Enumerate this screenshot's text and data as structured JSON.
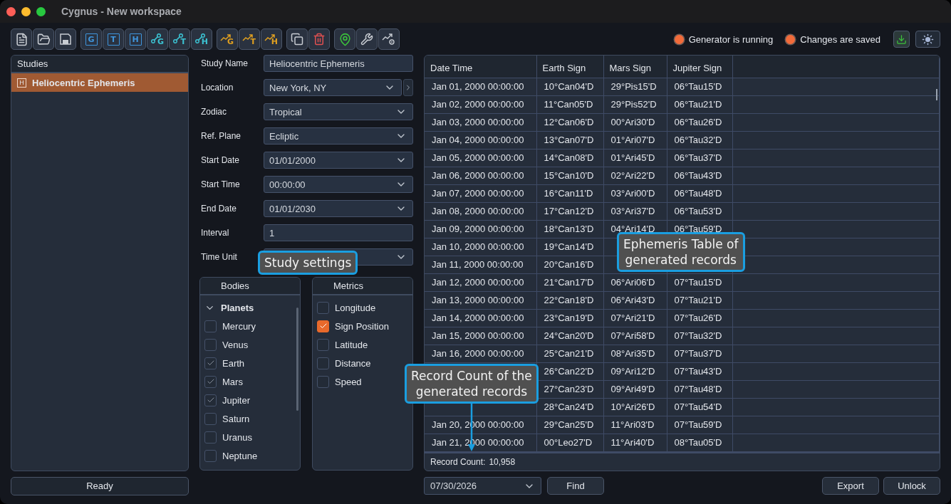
{
  "window": {
    "title": "Cygnus - New workspace"
  },
  "toolbar": {
    "groups": [
      [
        {
          "kind": "document"
        },
        {
          "kind": "folder"
        },
        {
          "kind": "save"
        }
      ],
      [
        {
          "kind": "boxed-letter",
          "letter": "G"
        },
        {
          "kind": "boxed-letter",
          "letter": "T"
        },
        {
          "kind": "boxed-letter",
          "letter": "H"
        },
        {
          "kind": "link-letter",
          "letter": "G"
        },
        {
          "kind": "link-letter",
          "letter": "T"
        },
        {
          "kind": "link-letter",
          "letter": "H"
        }
      ],
      [
        {
          "kind": "trend-letter",
          "letter": "G"
        },
        {
          "kind": "trend-letter",
          "letter": "T"
        },
        {
          "kind": "trend-letter",
          "letter": "H"
        }
      ],
      [
        {
          "kind": "copy"
        },
        {
          "kind": "trash"
        }
      ],
      [
        {
          "kind": "pin"
        },
        {
          "kind": "wrench"
        },
        {
          "kind": "trend-gear"
        }
      ]
    ]
  },
  "status": [
    {
      "label": "Generator is running",
      "on": true
    },
    {
      "label": "Changes are saved",
      "on": true
    }
  ],
  "studies": {
    "title": "Studies",
    "items": [
      {
        "label": "Heliocentric Ephemeris",
        "letter": "H",
        "selected": true
      }
    ],
    "status_button": "Ready"
  },
  "form": [
    {
      "label": "Study Name",
      "kind": "text",
      "value": "Heliocentric Ephemeris"
    },
    {
      "label": "Location",
      "kind": "select",
      "value": "New York, NY",
      "next_button": true
    },
    {
      "label": "Zodiac",
      "kind": "select",
      "value": "Tropical"
    },
    {
      "label": "Ref. Plane",
      "kind": "select",
      "value": "Ecliptic"
    },
    {
      "label": "Start Date",
      "kind": "select",
      "value": "01/01/2000"
    },
    {
      "label": "Start Time",
      "kind": "select",
      "value": "00:00:00"
    },
    {
      "label": "End Date",
      "kind": "select",
      "value": "01/01/2030"
    },
    {
      "label": "Interval",
      "kind": "text",
      "value": "1"
    },
    {
      "label": "Time Unit",
      "kind": "select"
    }
  ],
  "bodies": {
    "title": "Bodies",
    "tree": [
      {
        "label": "Planets",
        "expanded": true,
        "children": [
          {
            "label": "Mercury",
            "checked": false
          },
          {
            "label": "Venus",
            "checked": false
          },
          {
            "label": "Earth",
            "checked": true
          },
          {
            "label": "Mars",
            "checked": true
          },
          {
            "label": "Jupiter",
            "checked": true
          },
          {
            "label": "Saturn",
            "checked": false
          },
          {
            "label": "Uranus",
            "checked": false
          },
          {
            "label": "Neptune",
            "checked": false
          }
        ]
      }
    ]
  },
  "metrics": {
    "title": "Metrics",
    "items": [
      {
        "label": "Longitude",
        "checked": false
      },
      {
        "label": "Sign Position",
        "checked": true
      },
      {
        "label": "Latitude",
        "checked": false
      },
      {
        "label": "Distance",
        "checked": false
      },
      {
        "label": "Speed",
        "checked": false
      }
    ]
  },
  "table": {
    "columns": [
      "Date Time",
      "Earth Sign",
      "Mars Sign",
      "Jupiter Sign"
    ],
    "rows": [
      {
        "date": "Jan 01, 2000 00:00:00",
        "earth": "10°Can04'D",
        "mars": "29°Pis15'D",
        "jupiter": "06°Tau15'D"
      },
      {
        "date": "Jan 02, 2000 00:00:00",
        "earth": "11°Can05'D",
        "mars": "29°Pis52'D",
        "jupiter": "06°Tau21'D"
      },
      {
        "date": "Jan 03, 2000 00:00:00",
        "earth": "12°Can06'D",
        "mars": "00°Ari30'D",
        "jupiter": "06°Tau26'D"
      },
      {
        "date": "Jan 04, 2000 00:00:00",
        "earth": "13°Can07'D",
        "mars": "01°Ari07'D",
        "jupiter": "06°Tau32'D"
      },
      {
        "date": "Jan 05, 2000 00:00:00",
        "earth": "14°Can08'D",
        "mars": "01°Ari45'D",
        "jupiter": "06°Tau37'D"
      },
      {
        "date": "Jan 06, 2000 00:00:00",
        "earth": "15°Can10'D",
        "mars": "02°Ari22'D",
        "jupiter": "06°Tau43'D"
      },
      {
        "date": "Jan 07, 2000 00:00:00",
        "earth": "16°Can11'D",
        "mars": "03°Ari00'D",
        "jupiter": "06°Tau48'D"
      },
      {
        "date": "Jan 08, 2000 00:00:00",
        "earth": "17°Can12'D",
        "mars": "03°Ari37'D",
        "jupiter": "06°Tau53'D"
      },
      {
        "date": "Jan 09, 2000 00:00:00",
        "earth": "18°Can13'D",
        "mars": "04°Ari14'D",
        "jupiter": "06°Tau59'D"
      },
      {
        "date": "Jan 10, 2000 00:00:00",
        "earth": "19°Can14'D"
      },
      {
        "date": "Jan 11, 2000 00:00:00",
        "earth": "20°Can16'D"
      },
      {
        "date": "Jan 12, 2000 00:00:00",
        "earth": "21°Can17'D",
        "mars": "06°Ari06'D",
        "jupiter": "07°Tau15'D"
      },
      {
        "date": "Jan 13, 2000 00:00:00",
        "earth": "22°Can18'D",
        "mars": "06°Ari43'D",
        "jupiter": "07°Tau21'D"
      },
      {
        "date": "Jan 14, 2000 00:00:00",
        "earth": "23°Can19'D",
        "mars": "07°Ari21'D",
        "jupiter": "07°Tau26'D"
      },
      {
        "date": "Jan 15, 2000 00:00:00",
        "earth": "24°Can20'D",
        "mars": "07°Ari58'D",
        "jupiter": "07°Tau32'D"
      },
      {
        "date": "Jan 16, 2000 00:00:00",
        "earth": "25°Can21'D",
        "mars": "08°Ari35'D",
        "jupiter": "07°Tau37'D"
      },
      {
        "earth": "26°Can22'D",
        "mars": "09°Ari12'D",
        "jupiter": "07°Tau43'D"
      },
      {
        "earth": "27°Can23'D",
        "mars": "09°Ari49'D",
        "jupiter": "07°Tau48'D"
      },
      {
        "earth": "28°Can24'D",
        "mars": "10°Ari26'D",
        "jupiter": "07°Tau54'D"
      },
      {
        "date": "Jan 20, 2000 00:00:00",
        "earth": "29°Can25'D",
        "mars": "11°Ari03'D",
        "jupiter": "07°Tau59'D"
      },
      {
        "date": "Jan 21, 2000 00:00:00",
        "earth": "00°Leo27'D",
        "mars": "11°Ari40'D",
        "jupiter": "08°Tau05'D"
      }
    ],
    "record_count_label": "Record Count:",
    "record_count": "10,958"
  },
  "bottom": {
    "date": "07/30/2026",
    "find": "Find",
    "export": "Export",
    "unlock": "Unlock"
  },
  "callouts": {
    "settings": "Study settings",
    "table": "Ephemeris Table of\ngenerated records",
    "count": "Record Count of the\ngenerated records"
  }
}
